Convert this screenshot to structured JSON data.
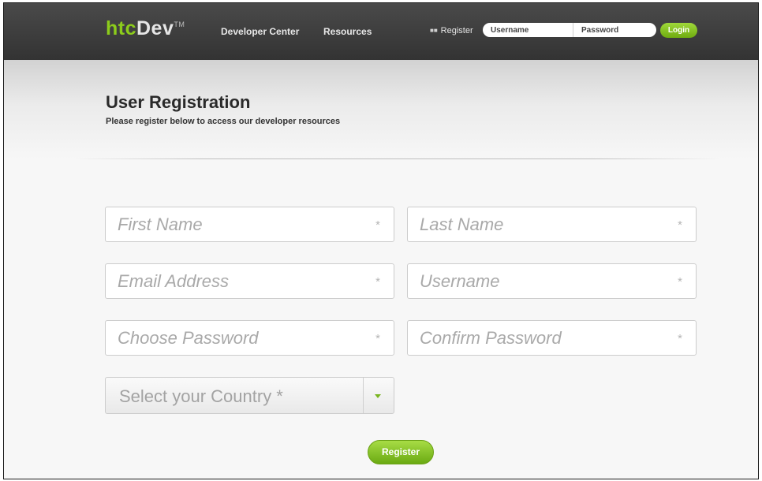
{
  "header": {
    "logo": {
      "htc": "htc",
      "dev": "Dev",
      "tm": "TM"
    },
    "nav": [
      "Developer Center",
      "Resources"
    ],
    "register_link": "Register",
    "login": {
      "username_placeholder": "Username",
      "password_placeholder": "Password",
      "button": "Login"
    }
  },
  "page": {
    "title": "User Registration",
    "subtitle": "Please register below to access our developer resources"
  },
  "form": {
    "first_name": "First Name",
    "last_name": "Last Name",
    "email": "Email Address",
    "username": "Username",
    "password": "Choose Password",
    "confirm_password": "Confirm Password",
    "required_mark": "*",
    "country_select": "Select your Country *",
    "submit": "Register"
  },
  "colors": {
    "accent_green": "#7ab51d",
    "topbar": "#3a3a3a"
  }
}
